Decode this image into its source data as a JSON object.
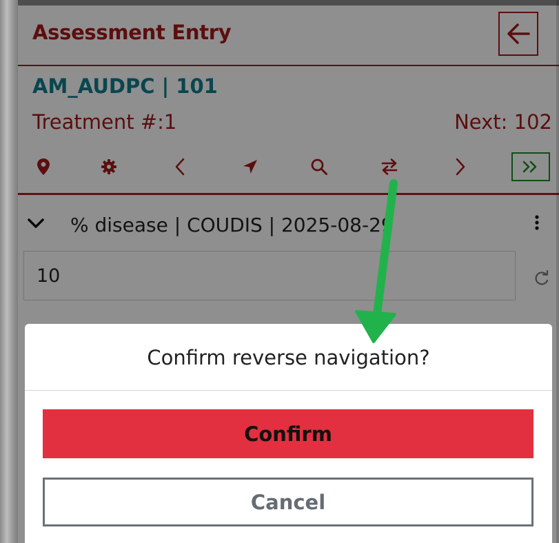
{
  "header": {
    "title": "Assessment Entry",
    "back_icon": "arrow-left-icon"
  },
  "trial": {
    "label": "AM_AUDPC | 101",
    "treatment": "Treatment #:1",
    "next": "Next: 102"
  },
  "toolbar": {
    "icons": [
      "map-marker-icon",
      "gear-icon",
      "chevron-left-icon",
      "location-arrow-icon",
      "search-icon",
      "swap-arrows-icon",
      "chevron-right-icon",
      "fast-forward-icon"
    ]
  },
  "variable": {
    "label": "% disease | COUDIS | 2025-08-29",
    "value": "10"
  },
  "dialog": {
    "title": "Confirm reverse navigation?",
    "confirm_label": "Confirm",
    "cancel_label": "Cancel"
  },
  "colors": {
    "brand_red": "#a51a1a",
    "trial_teal": "#127d8e",
    "confirm_red": "#e23040",
    "annotation_green": "#22b24c"
  }
}
